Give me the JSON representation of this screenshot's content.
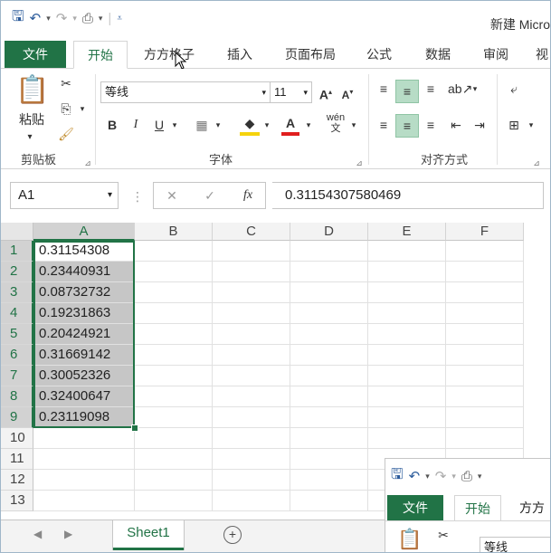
{
  "title": "新建 Micro",
  "tabs": [
    {
      "label": "文件"
    },
    {
      "label": "开始"
    },
    {
      "label": "方方格子"
    },
    {
      "label": "插入"
    },
    {
      "label": "页面布局"
    },
    {
      "label": "公式"
    },
    {
      "label": "数据"
    },
    {
      "label": "审阅"
    },
    {
      "label": "视"
    }
  ],
  "ribbon": {
    "paste_label": "粘贴",
    "font_name": "等线",
    "font_size": "11",
    "groups": {
      "clipboard": "剪贴板",
      "font": "字体",
      "alignment": "对齐方式"
    }
  },
  "formula_bar": {
    "name_box": "A1",
    "formula": "0.31154307580469"
  },
  "grid": {
    "columns": [
      "A",
      "B",
      "C",
      "D",
      "E",
      "F"
    ],
    "rows": [
      "1",
      "2",
      "3",
      "4",
      "5",
      "6",
      "7",
      "8",
      "9",
      "10",
      "11",
      "12",
      "13"
    ],
    "values": [
      "0.31154308",
      "0.23440931",
      "0.08732732",
      "0.19231863",
      "0.20424921",
      "0.31669142",
      "0.30052326",
      "0.32400647",
      "0.23119098"
    ]
  },
  "sheets": [
    {
      "label": "Sheet1"
    }
  ],
  "window2": {
    "tabs": [
      {
        "label": "文件"
      },
      {
        "label": "开始"
      },
      {
        "label": "方方"
      }
    ],
    "font_name": "等线"
  }
}
